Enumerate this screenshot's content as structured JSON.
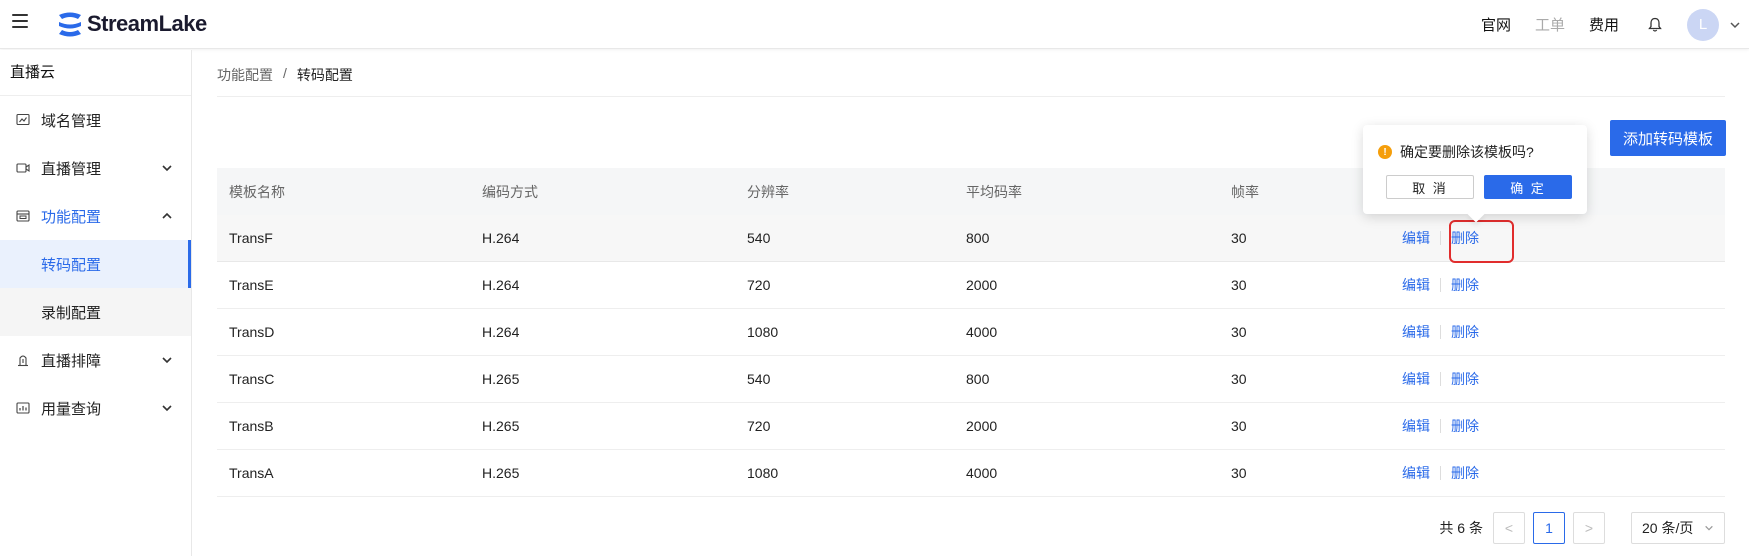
{
  "header": {
    "brand": "StreamLake",
    "nav": [
      "官网",
      "工单",
      "费用"
    ],
    "avatar_letter": "L",
    "icons": [
      "menu-icon",
      "bell-icon",
      "chevron-down-icon"
    ],
    "accent_color": "#2a6ae9"
  },
  "sidebar": {
    "title": "直播云",
    "items": [
      {
        "label": "域名管理",
        "icon": "domain-icon"
      },
      {
        "label": "直播管理",
        "icon": "camera-icon"
      },
      {
        "label": "功能配置",
        "icon": "config-icon"
      },
      {
        "label": "转码配置"
      },
      {
        "label": "录制配置"
      },
      {
        "label": "直播排障",
        "icon": "troubleshoot-icon"
      },
      {
        "label": "用量查询",
        "icon": "usage-icon"
      }
    ]
  },
  "breadcrumb": {
    "parent": "功能配置",
    "separator": "/",
    "current": "转码配置"
  },
  "toolbar": {
    "add_label": "添加转码模板"
  },
  "table": {
    "columns": [
      "模板名称",
      "编码方式",
      "分辨率",
      "平均码率",
      "帧率"
    ],
    "rows": [
      {
        "name": "TransF",
        "codec": "H.264",
        "resolution": "540",
        "bitrate": "800",
        "fps": "30"
      },
      {
        "name": "TransE",
        "codec": "H.264",
        "resolution": "720",
        "bitrate": "2000",
        "fps": "30"
      },
      {
        "name": "TransD",
        "codec": "H.264",
        "resolution": "1080",
        "bitrate": "4000",
        "fps": "30"
      },
      {
        "name": "TransC",
        "codec": "H.265",
        "resolution": "540",
        "bitrate": "800",
        "fps": "30"
      },
      {
        "name": "TransB",
        "codec": "H.265",
        "resolution": "720",
        "bitrate": "2000",
        "fps": "30"
      },
      {
        "name": "TransA",
        "codec": "H.265",
        "resolution": "1080",
        "bitrate": "4000",
        "fps": "30"
      }
    ],
    "edit_label": "编辑",
    "delete_label": "删除"
  },
  "popconfirm": {
    "message": "确定要删除该模板吗?",
    "cancel_label": "取 消",
    "ok_label": "确 定",
    "warn_icon_glyph": "!"
  },
  "pagination": {
    "total": "共 6 条",
    "prev": "<",
    "current_page": "1",
    "next": ">",
    "page_size": "20 条/页"
  }
}
